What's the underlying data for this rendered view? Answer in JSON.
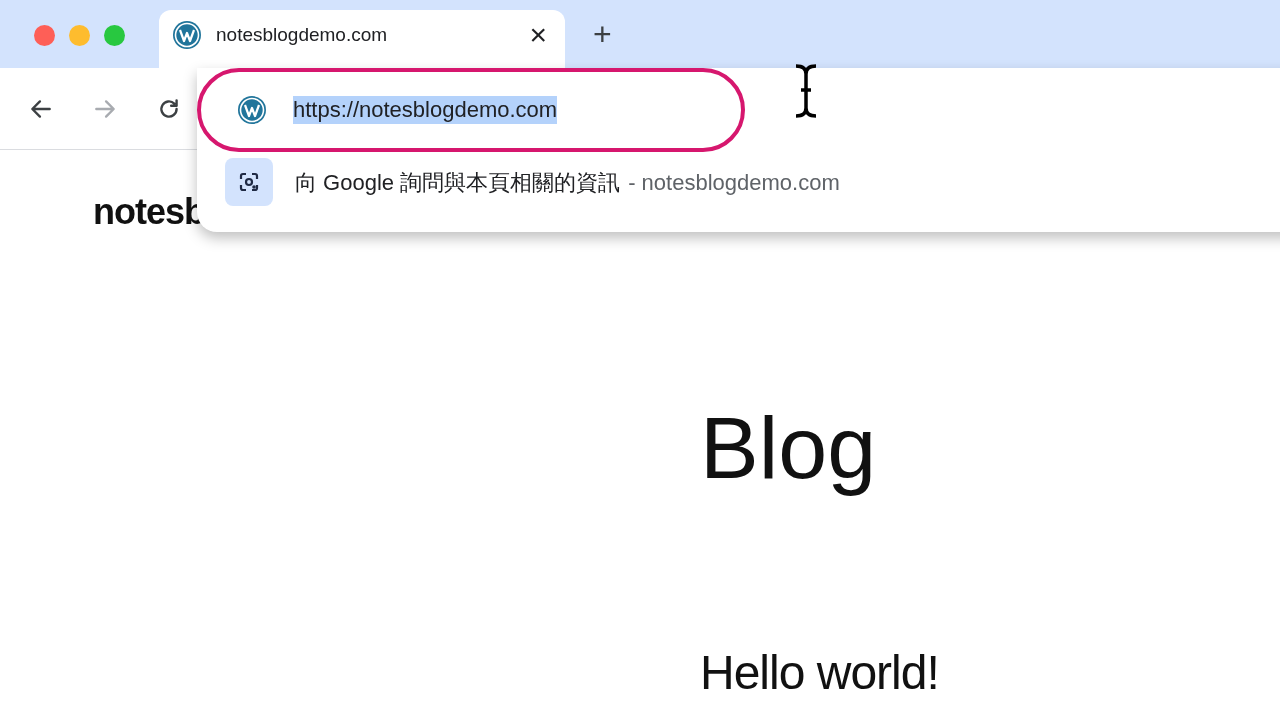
{
  "tab": {
    "title": "notesblogdemo.com",
    "close": "×",
    "new_tab": "+"
  },
  "nav_buttons": [
    {
      "kind": "back",
      "disabled": false
    },
    {
      "kind": "forward",
      "disabled": true
    },
    {
      "kind": "reload",
      "disabled": false
    }
  ],
  "omnibox": {
    "url": "https://notesblogdemo.com",
    "selected": true,
    "highlighted": true
  },
  "suggestion": {
    "text": "向 Google 詢問與本頁相關的資訊",
    "site": "- notesblogdemo.com"
  },
  "page": {
    "site_title": "notesb",
    "heading": "Blog",
    "post_title": "Hello world!"
  }
}
